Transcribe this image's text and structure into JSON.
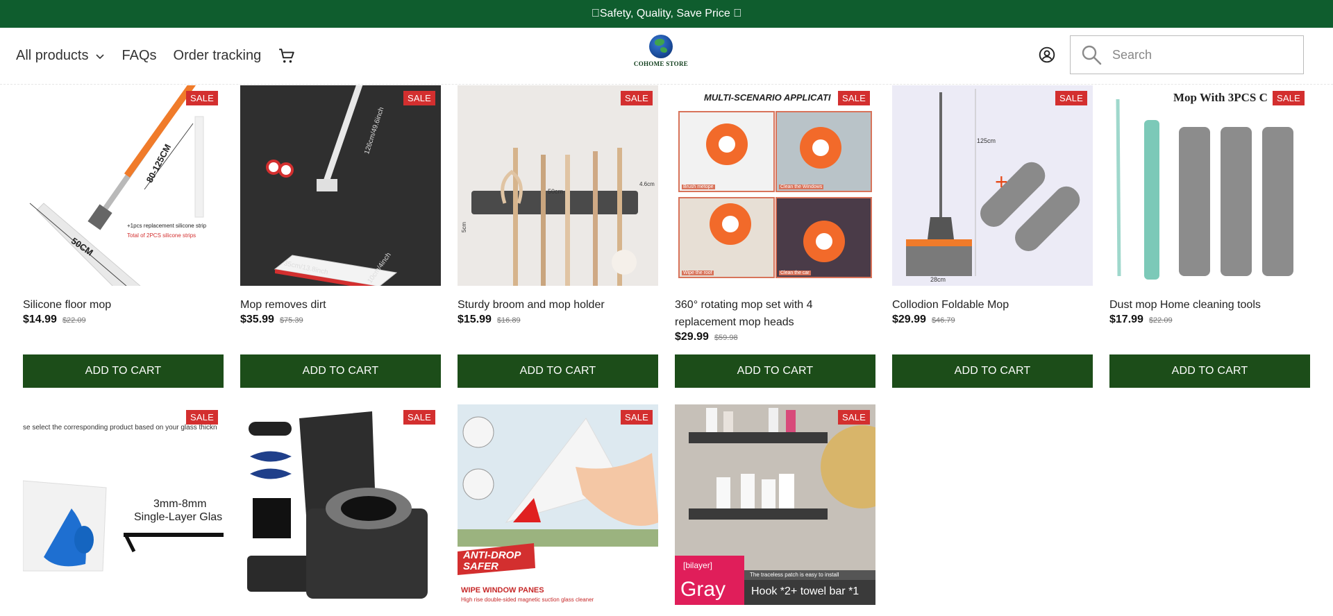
{
  "announcement": "Safety, Quality, Save Price ",
  "nav": {
    "all_products": "All products",
    "faqs": "FAQs",
    "order_tracking": "Order tracking"
  },
  "logo": {
    "text": "COHOME STORE"
  },
  "search": {
    "placeholder": "Search"
  },
  "icons": {
    "cart": "cart-icon",
    "account": "account-icon",
    "search": "search-icon",
    "dropdown": "chevron-down-icon"
  },
  "colors": {
    "announcement_bg": "#0f5d2e",
    "button_bg": "#1c4d19",
    "sale_badge": "#d32f2f"
  },
  "products": [
    {
      "title": "Silicone floor mop",
      "price": "$14.99",
      "old_price": "$22.09",
      "badge": "SALE",
      "button": "ADD TO CART",
      "image_text": [
        "80-125CM",
        "50CM",
        "+1pcs replacement silicone strip",
        "Total of 2PCS silicone strips"
      ]
    },
    {
      "title": "Mop removes dirt",
      "price": "$35.99",
      "old_price": "$75.39",
      "badge": "SALE",
      "button": "ADD TO CART",
      "image_text": [
        "126cm/49.6inch",
        "35cm/13.8inch",
        "10cm/4inch"
      ]
    },
    {
      "title": "Sturdy broom and mop holder",
      "price": "$15.99",
      "old_price": "$16.89",
      "badge": "SALE",
      "button": "ADD TO CART",
      "image_text": [
        "50cm",
        "4.6cm",
        "5cm"
      ]
    },
    {
      "title": "360° rotating mop set with 4 replacement mop heads",
      "price": "$29.99",
      "old_price": "$59.98",
      "badge": "SALE",
      "button": "ADD TO CART",
      "image_text": [
        "MULTI-SCENARIO APPLICATI",
        "Brush metope",
        "Clean the Windows",
        "Wipe the roof",
        "Clean the car"
      ]
    },
    {
      "title": "Collodion Foldable Mop",
      "price": "$29.99",
      "old_price": "$46.79",
      "badge": "SALE",
      "button": "ADD TO CART",
      "image_text": [
        "125cm",
        "28cm"
      ]
    },
    {
      "title": "Dust mop Home cleaning tools",
      "price": "$17.99",
      "old_price": "$22.09",
      "badge": "SALE",
      "button": "ADD TO CART",
      "image_text": [
        "Mop With 3PCS C"
      ]
    },
    {
      "badge": "SALE",
      "image_text": [
        "se select the corresponding product based on your glass thickn",
        "3mm-8mm",
        "Single-Layer Glas"
      ]
    },
    {
      "badge": "SALE",
      "image_text": []
    },
    {
      "badge": "SALE",
      "image_text": [
        "ANTI-DROP SAFER",
        "WIPE WINDOW PANES",
        "High rise double-sided magnetic suction glass cleaner"
      ]
    },
    {
      "badge": "SALE",
      "image_text": [
        "[bilayer]",
        "Gray",
        "The traceless patch is easy to install",
        "Hook *2+ towel bar *1"
      ]
    }
  ]
}
